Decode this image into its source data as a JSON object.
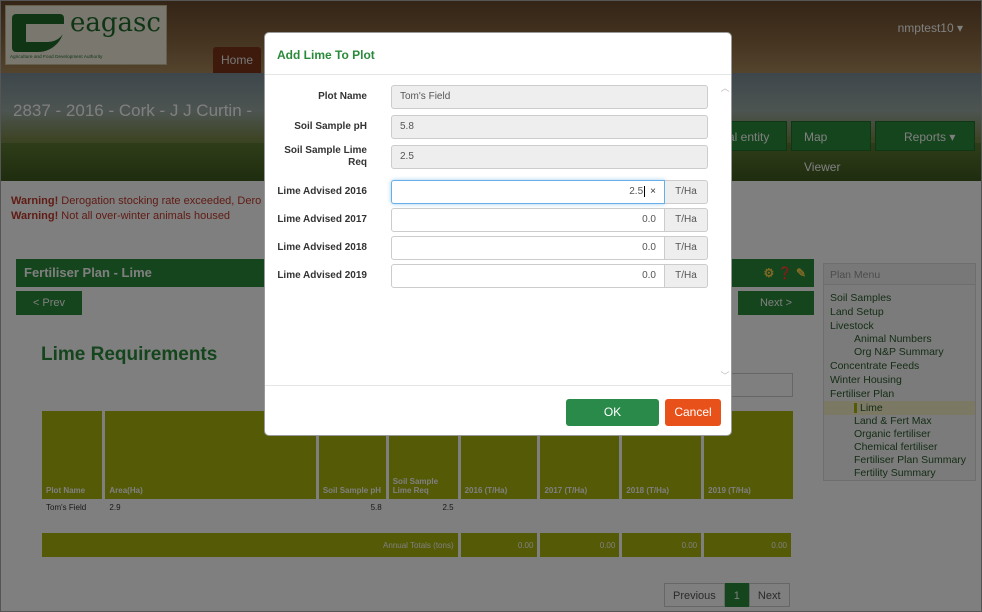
{
  "header": {
    "logo_word": "eagasc",
    "logo_sub": "Agriculture and Food Development Authority",
    "home_tab": "Home",
    "user": "nmptest10 ▾"
  },
  "banner": {
    "farm_title": "2837 - 2016 - Cork - J J Curtin -",
    "nav": [
      "al entity",
      "Map Viewer",
      "Reports ▾"
    ]
  },
  "warnings": [
    {
      "label": "Warning!",
      "text": " Derogation stocking rate exceeded, Dero"
    },
    {
      "label": "Warning!",
      "text": " Not all over-winter animals housed"
    }
  ],
  "section": {
    "title": "Fertiliser Plan - Lime",
    "prev": "< Prev",
    "next": "Next >"
  },
  "lime_title": "Lime Requirements",
  "table": {
    "headers": [
      "Plot Name",
      "Area(Ha)",
      "Soil Sample pH",
      "Soil Sample Lime Req",
      "2016 (T/Ha)",
      "2017 (T/Ha)",
      "2018 (T/Ha)",
      "2019 (T/Ha)"
    ],
    "rows": [
      [
        "Tom's Field",
        "2.9",
        "5.8",
        "2.5",
        "",
        "",
        "",
        ""
      ]
    ],
    "totals_label": "Annual Totals (tons)",
    "totals": [
      "0.00",
      "0.00",
      "0.00",
      "0.00"
    ]
  },
  "pager": {
    "previous": "Previous",
    "current": "1",
    "next": "Next"
  },
  "plan_menu": {
    "title": "Plan Menu",
    "items": [
      {
        "label": "Soil Samples",
        "level": 0
      },
      {
        "label": "Land Setup",
        "level": 0
      },
      {
        "label": "Livestock",
        "level": 0
      },
      {
        "label": "Animal Numbers",
        "level": 1
      },
      {
        "label": "Org N&P Summary",
        "level": 1
      },
      {
        "label": "Concentrate Feeds",
        "level": 0
      },
      {
        "label": "Winter Housing",
        "level": 0
      },
      {
        "label": "Fertiliser Plan",
        "level": 0
      },
      {
        "label": "Lime",
        "level": 1,
        "active": true
      },
      {
        "label": "Land & Fert Max",
        "level": 1
      },
      {
        "label": "Organic fertiliser",
        "level": 1
      },
      {
        "label": "Chemical fertiliser",
        "level": 1
      },
      {
        "label": "Fertiliser Plan Summary",
        "level": 1
      },
      {
        "label": "Fertility Summary",
        "level": 1
      }
    ]
  },
  "modal": {
    "title": "Add Lime To Plot",
    "fields": {
      "plot_name": {
        "label": "Plot Name",
        "value": "Tom's Field"
      },
      "soil_ph": {
        "label": "Soil Sample pH",
        "value": "5.8"
      },
      "lime_req": {
        "label": "Soil Sample Lime Req",
        "value": "2.5"
      },
      "lime_2016": {
        "label": "Lime Advised 2016",
        "value": "2.5",
        "unit": "T/Ha"
      },
      "lime_2017": {
        "label": "Lime Advised 2017",
        "value": "0.0",
        "unit": "T/Ha"
      },
      "lime_2018": {
        "label": "Lime Advised 2018",
        "value": "0.0",
        "unit": "T/Ha"
      },
      "lime_2019": {
        "label": "Lime Advised 2019",
        "value": "0.0",
        "unit": "T/Ha"
      }
    },
    "ok": "OK",
    "cancel": "Cancel"
  },
  "colors": {
    "brand_green": "#2a8a3a",
    "olive": "#a8b40d",
    "cancel_orange": "#e8521a",
    "warning_red": "#c0392b"
  }
}
